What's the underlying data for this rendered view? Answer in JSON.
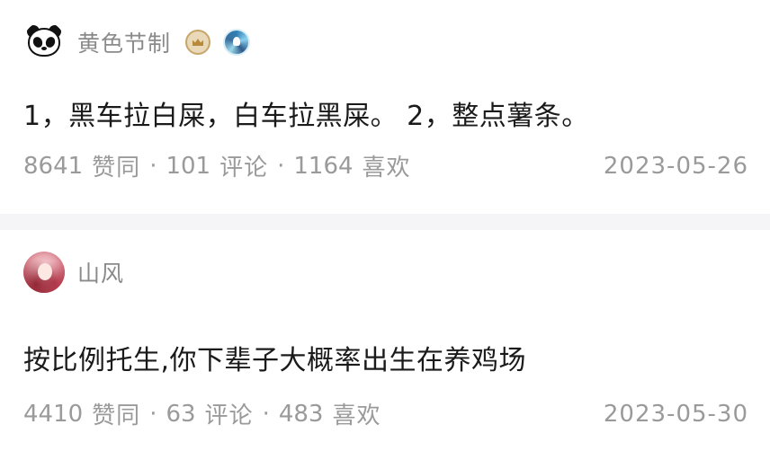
{
  "answers": [
    {
      "author": "黄色节制",
      "content": "1，黑车拉白屎，白车拉黑屎。 2，整点薯条。",
      "upvotes": "8641",
      "upvote_label": "赞同",
      "comments": "101",
      "comment_label": "评论",
      "likes": "1164",
      "like_label": "喜欢",
      "date": "2023-05-26",
      "avatar_icon": "panda-avatar",
      "badges": [
        "crown-badge-icon",
        "medal-badge-icon"
      ]
    },
    {
      "author": "山风",
      "content": "按比例托生,你下辈子大概率出生在养鸡场",
      "upvotes": "4410",
      "upvote_label": "赞同",
      "comments": "63",
      "comment_label": "评论",
      "likes": "483",
      "like_label": "喜欢",
      "date": "2023-05-30",
      "avatar_icon": "girl-avatar"
    }
  ],
  "separator": "·",
  "colors": {
    "text_primary": "#1a1a1a",
    "text_meta": "#9a9a9a",
    "author": "#8a8a8a",
    "divider": "#f5f5f7"
  }
}
